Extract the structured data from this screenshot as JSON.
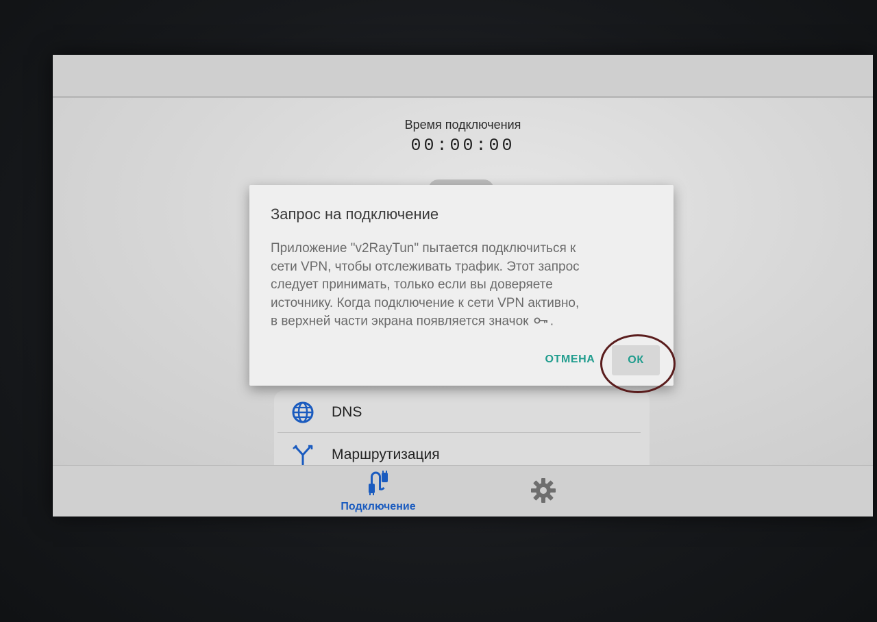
{
  "app": {
    "connection_time_label": "Время подключения",
    "connection_time_value": "00:00:00"
  },
  "settings_list": {
    "items": [
      {
        "label": "DNS",
        "icon": "globe-icon"
      },
      {
        "label": "Маршрутизация",
        "icon": "route-split-icon"
      }
    ]
  },
  "bottom_nav": {
    "connection_label": "Подключение",
    "connection_icon": "plug-connection-icon",
    "settings_icon": "gear-icon"
  },
  "dialog": {
    "title": "Запрос на подключение",
    "body_lines": [
      "Приложение \"v2RayTun\" пытается подключиться к",
      "сети VPN, чтобы отслеживать трафик. Этот запрос",
      "следует принимать, только если вы доверяете",
      "источнику. Когда подключение к сети VPN активно,",
      "в верхней части экрана появляется значок"
    ],
    "body_end": ".",
    "cancel_label": "ОТМЕНА",
    "ok_label": "ОК"
  },
  "colors": {
    "accent_teal": "#1f9c8d",
    "accent_blue": "#1a5bbf",
    "circle_annotation": "#5a1d1d"
  }
}
